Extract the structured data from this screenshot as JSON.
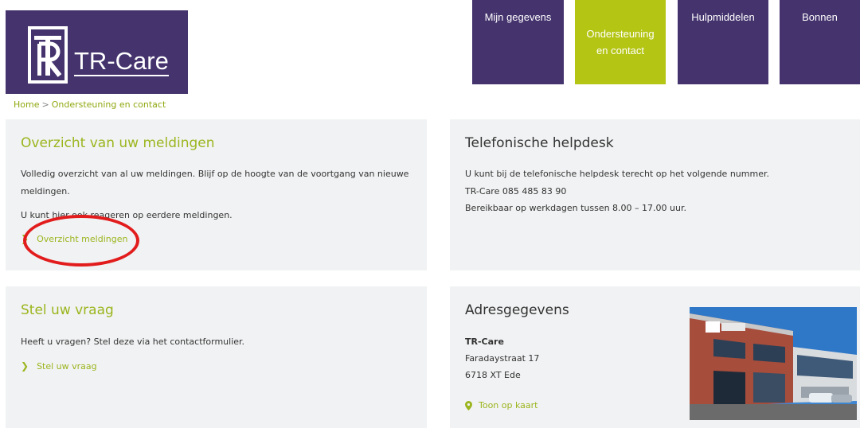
{
  "brand": {
    "name": "TR-Care"
  },
  "nav": [
    {
      "label": "Mijn gegevens",
      "active": false
    },
    {
      "label": "Ondersteuning\nen contact",
      "active": true
    },
    {
      "label": "Hulpmiddelen",
      "active": false
    },
    {
      "label": "Bonnen",
      "active": false
    }
  ],
  "breadcrumb": {
    "home": "Home",
    "separator": ">",
    "current": "Ondersteuning en contact"
  },
  "cards": {
    "overview": {
      "title": "Overzicht van uw meldingen",
      "line1": "Volledig overzicht van al uw meldingen. Blijf op de hoogte van de voortgang van nieuwe",
      "line2": "meldingen.",
      "line3": "U kunt hier ook reageren op eerdere meldingen.",
      "link": "Overzicht meldingen"
    },
    "helpdesk": {
      "title": "Telefonische helpdesk",
      "line1": "U kunt bij de telefonische helpdesk terecht op het volgende nummer.",
      "line2": "TR-Care 085 485 83 90",
      "line3": "Bereikbaar op werkdagen tussen 8.00 – 17.00 uur."
    },
    "question": {
      "title": "Stel uw vraag",
      "line1": "Heeft u vragen? Stel deze via het contactformulier.",
      "link": "Stel uw vraag"
    },
    "address": {
      "title": "Adresgegevens",
      "company": "TR-Care",
      "street": "Faradaystraat 17",
      "city": "6718 XT Ede",
      "link": "Toon op kaart"
    }
  },
  "colors": {
    "brand_purple": "#44336d",
    "accent_green": "#b4c514",
    "link_green": "#9bb51e",
    "annotation_red": "#e21c1c"
  },
  "icons": [
    "tr-logo-icon",
    "chevron-right-icon",
    "map-pin-icon"
  ]
}
